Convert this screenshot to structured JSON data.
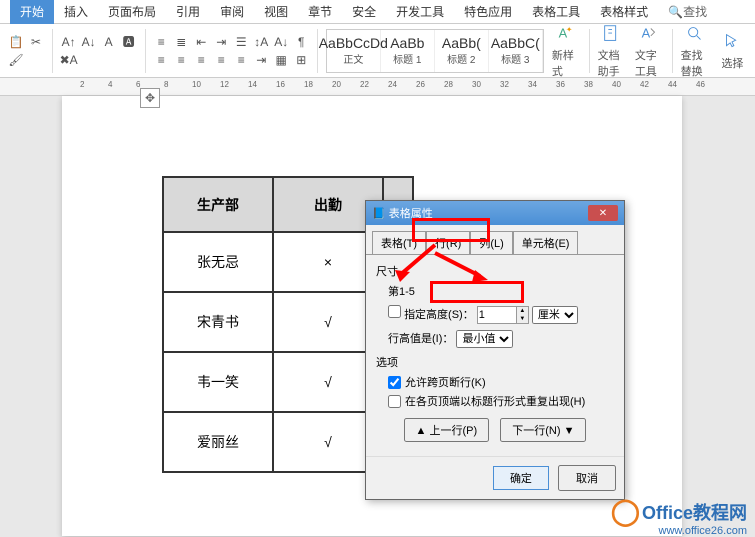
{
  "ribbon": {
    "tabs": [
      "开始",
      "插入",
      "页面布局",
      "引用",
      "审阅",
      "视图",
      "章节",
      "安全",
      "开发工具",
      "特色应用",
      "表格工具",
      "表格样式"
    ],
    "active": 0,
    "search": "查找",
    "styleItems": [
      {
        "preview": "AaBbCcDd",
        "label": "正文"
      },
      {
        "preview": "AaBb",
        "label": "标题 1"
      },
      {
        "preview": "AaBb(",
        "label": "标题 2"
      },
      {
        "preview": "AaBbC(",
        "label": "标题 3"
      }
    ],
    "bigButtons": {
      "newStyle": "新样式",
      "docHelper": "文档助手",
      "textTools": "文字工具",
      "findReplace": "查找替换",
      "select": "选择"
    }
  },
  "ruler": {
    "marks": [
      "2",
      "4",
      "6",
      "8",
      "10",
      "12",
      "14",
      "16",
      "18",
      "20",
      "22",
      "24",
      "26",
      "28",
      "30",
      "32",
      "34",
      "36",
      "38",
      "40",
      "42",
      "44",
      "46"
    ]
  },
  "table": {
    "headers": [
      "生产部",
      "出勤",
      ""
    ],
    "rows": [
      [
        "张无忌",
        "×"
      ],
      [
        "宋青书",
        "√"
      ],
      [
        "韦一笑",
        "√"
      ],
      [
        "爱丽丝",
        "√"
      ]
    ]
  },
  "dialog": {
    "title": "表格属性",
    "tabs": {
      "table": "表格(T)",
      "row": "行(R)",
      "column": "列(L)",
      "cell": "单元格(E)"
    },
    "size": "尺寸",
    "rowLabel": "第1-5",
    "specifyHeight": "指定高度(S)：",
    "heightValue": "1",
    "heightUnit": "厘米",
    "heightType": "行高值是(I)：",
    "heightTypeValue": "最小值",
    "options": "选项",
    "allowBreak": "允许跨页断行(K)",
    "repeatHeader": "在各页顶端以标题行形式重复出现(H)",
    "prevRow": "上一行(P)",
    "nextRow": "下一行(N)",
    "ok": "确定",
    "cancel": "取消"
  },
  "watermark": {
    "brand": "Office教程网",
    "url": "www.office26.com"
  }
}
